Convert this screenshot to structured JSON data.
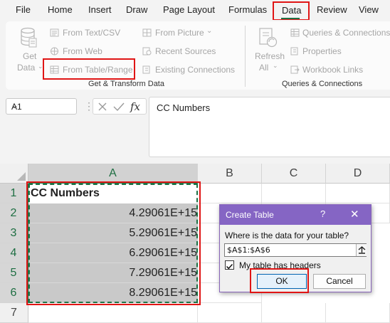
{
  "colors": {
    "excel_green": "#1e7145",
    "highlight_red": "#e01515",
    "dialog_purple": "#8565c4",
    "disabled_text": "#a6a6a6"
  },
  "menu": {
    "items": [
      "File",
      "Home",
      "Insert",
      "Draw",
      "Page Layout",
      "Formulas",
      "Data",
      "Review",
      "View"
    ],
    "active": "Data"
  },
  "ribbon": {
    "get_data_label_1": "Get",
    "get_data_label_2": "Data",
    "from_text_csv": "From Text/CSV",
    "from_web": "From Web",
    "from_table_range": "From Table/Range",
    "from_picture": "From Picture",
    "recent_sources": "Recent Sources",
    "existing_connections": "Existing Connections",
    "group_get_transform": "Get & Transform Data",
    "refresh_all_1": "Refresh",
    "refresh_all_2": "All",
    "queries_connections": "Queries & Connections",
    "properties": "Properties",
    "workbook_links": "Workbook Links",
    "group_queries": "Queries & Connections"
  },
  "formula_bar": {
    "name_box": "A1",
    "formula": "CC Numbers",
    "icons": [
      "cancel-icon",
      "enter-icon",
      "fx-icon"
    ]
  },
  "sheet": {
    "columns": [
      "A",
      "B",
      "C",
      "D"
    ],
    "selected_column": "A",
    "rows": [
      "1",
      "2",
      "3",
      "4",
      "5",
      "6",
      "7"
    ],
    "cells_A": [
      "CC Numbers",
      "4.29061E+15",
      "5.29061E+15",
      "6.29061E+15",
      "7.29061E+15",
      "8.29061E+15"
    ]
  },
  "dialog": {
    "title": "Create Table",
    "help": "?",
    "close": "✕",
    "prompt": "Where is the data for your table?",
    "range": "$A$1:$A$6",
    "has_headers_label": "My table has headers",
    "has_headers_checked": true,
    "ok": "OK",
    "cancel": "Cancel"
  }
}
